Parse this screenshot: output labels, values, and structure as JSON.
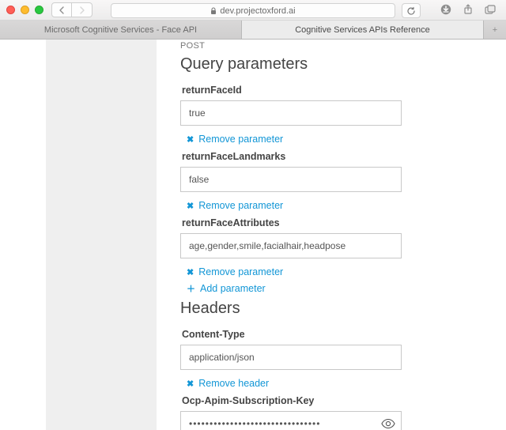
{
  "browser": {
    "url": "dev.projectoxford.ai",
    "tabs": [
      {
        "label": "Microsoft Cognitive Services - Face API",
        "active": false
      },
      {
        "label": "Cognitive Services APIs Reference",
        "active": true
      }
    ]
  },
  "page": {
    "method": "POST",
    "sections": {
      "query_params": {
        "title": "Query parameters",
        "params": [
          {
            "name": "returnFaceId",
            "value": "true",
            "remove_label": "Remove parameter"
          },
          {
            "name": "returnFaceLandmarks",
            "value": "false",
            "remove_label": "Remove parameter"
          },
          {
            "name": "returnFaceAttributes",
            "value": "age,gender,smile,facialhair,headpose",
            "remove_label": "Remove parameter"
          }
        ],
        "add_label": "Add parameter"
      },
      "headers": {
        "title": "Headers",
        "items": [
          {
            "name": "Content-Type",
            "value": "application/json",
            "remove_label": "Remove header"
          },
          {
            "name": "Ocp-Apim-Subscription-Key",
            "value": "••••••••••••••••••••••••••••••••",
            "masked": true
          }
        ]
      }
    }
  }
}
